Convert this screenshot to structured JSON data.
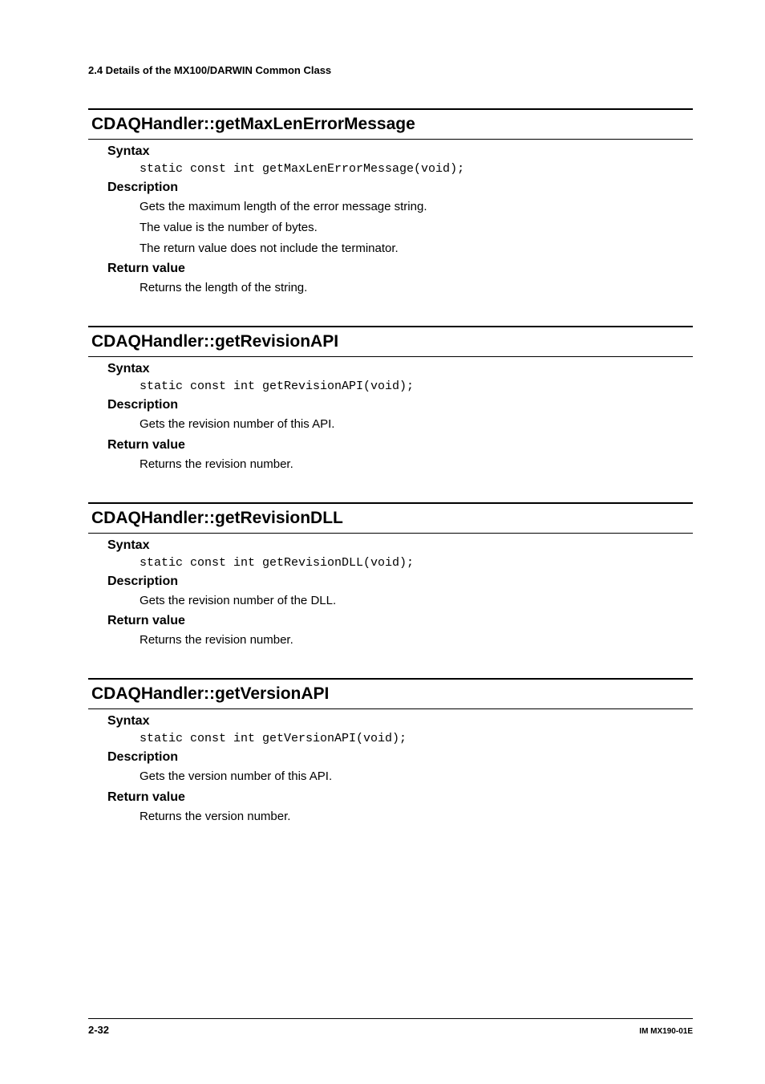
{
  "page_header": "2.4  Details of the MX100/DARWIN Common Class",
  "sections": [
    {
      "title": "CDAQHandler::getMaxLenErrorMessage",
      "syntax_label": "Syntax",
      "syntax_code": "static const int getMaxLenErrorMessage(void);",
      "description_label": "Description",
      "description_lines": [
        "Gets the maximum length of the error message string.",
        "The value is the number of bytes.",
        "The return value does not include the terminator."
      ],
      "return_label": "Return value",
      "return_text": "Returns the length of the string."
    },
    {
      "title": "CDAQHandler::getRevisionAPI",
      "syntax_label": "Syntax",
      "syntax_code": "static const int getRevisionAPI(void);",
      "description_label": "Description",
      "description_lines": [
        "Gets the revision number of this API."
      ],
      "return_label": "Return value",
      "return_text": "Returns the revision number."
    },
    {
      "title": "CDAQHandler::getRevisionDLL",
      "syntax_label": "Syntax",
      "syntax_code": "static const int getRevisionDLL(void);",
      "description_label": "Description",
      "description_lines": [
        "Gets the revision number of the DLL."
      ],
      "return_label": "Return value",
      "return_text": "Returns the revision number."
    },
    {
      "title": "CDAQHandler::getVersionAPI",
      "syntax_label": "Syntax",
      "syntax_code": "static const int getVersionAPI(void);",
      "description_label": "Description",
      "description_lines": [
        "Gets the version number of this API."
      ],
      "return_label": "Return value",
      "return_text": "Returns the version number."
    }
  ],
  "footer": {
    "page_number": "2-32",
    "doc_id": "IM MX190-01E"
  }
}
